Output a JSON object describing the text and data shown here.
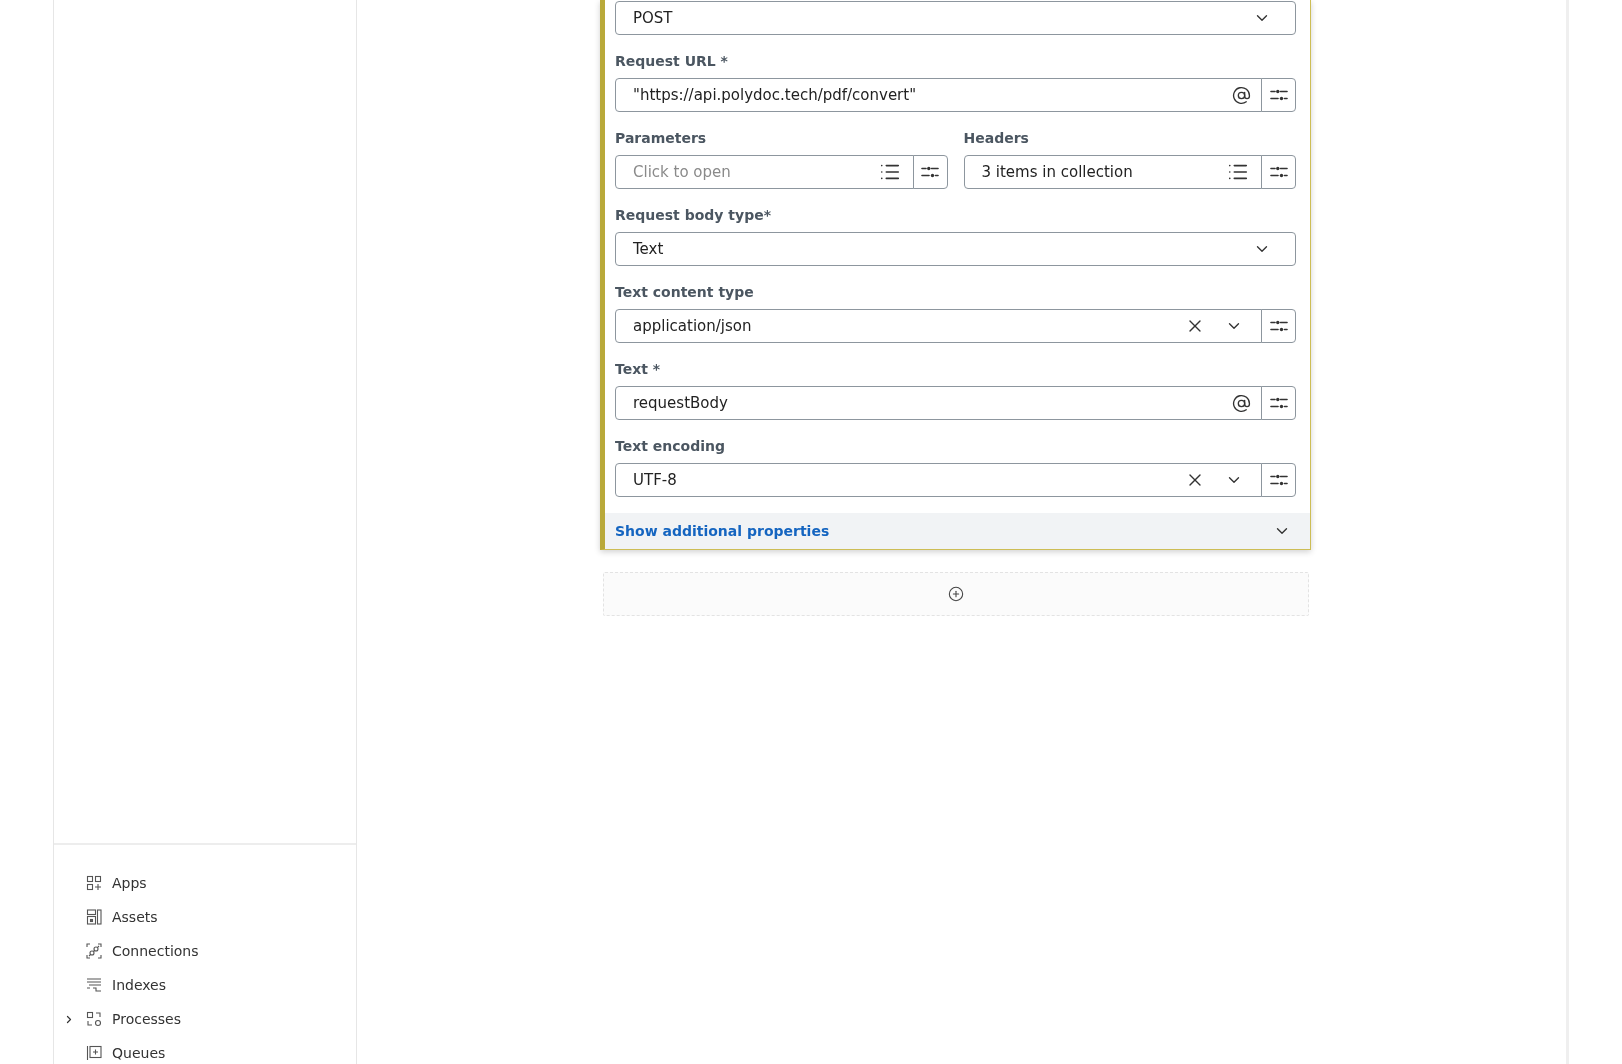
{
  "sidebar": {
    "nav_items": [
      {
        "label": "Apps",
        "expandable": false
      },
      {
        "label": "Assets",
        "expandable": false
      },
      {
        "label": "Connections",
        "expandable": false
      },
      {
        "label": "Indexes",
        "expandable": false
      },
      {
        "label": "Processes",
        "expandable": true,
        "expanded": false
      },
      {
        "label": "Queues",
        "expandable": false
      }
    ]
  },
  "step_card": {
    "rows": [
      [
        {
          "kind": "select",
          "value": "POST"
        }
      ],
      [
        {
          "kind": "expression",
          "label": "Request URL *",
          "value": "\"https://api.polydoc.tech/pdf/convert\""
        }
      ],
      [
        {
          "kind": "collection",
          "label": "Parameters",
          "placeholder": "Click to open"
        },
        {
          "kind": "collection",
          "label": "Headers",
          "value": "3 items in collection"
        }
      ],
      [
        {
          "kind": "select",
          "label": "Request body type*",
          "value": "Text"
        }
      ],
      [
        {
          "kind": "clearable_select",
          "label": "Text content type",
          "value": "application/json"
        }
      ],
      [
        {
          "kind": "expression",
          "label": "Text *",
          "value": "requestBody"
        }
      ],
      [
        {
          "kind": "clearable_select",
          "label": "Text encoding",
          "value": "UTF-8"
        }
      ]
    ],
    "additional_properties": {
      "label": "Show additional properties",
      "expanded": false
    }
  }
}
